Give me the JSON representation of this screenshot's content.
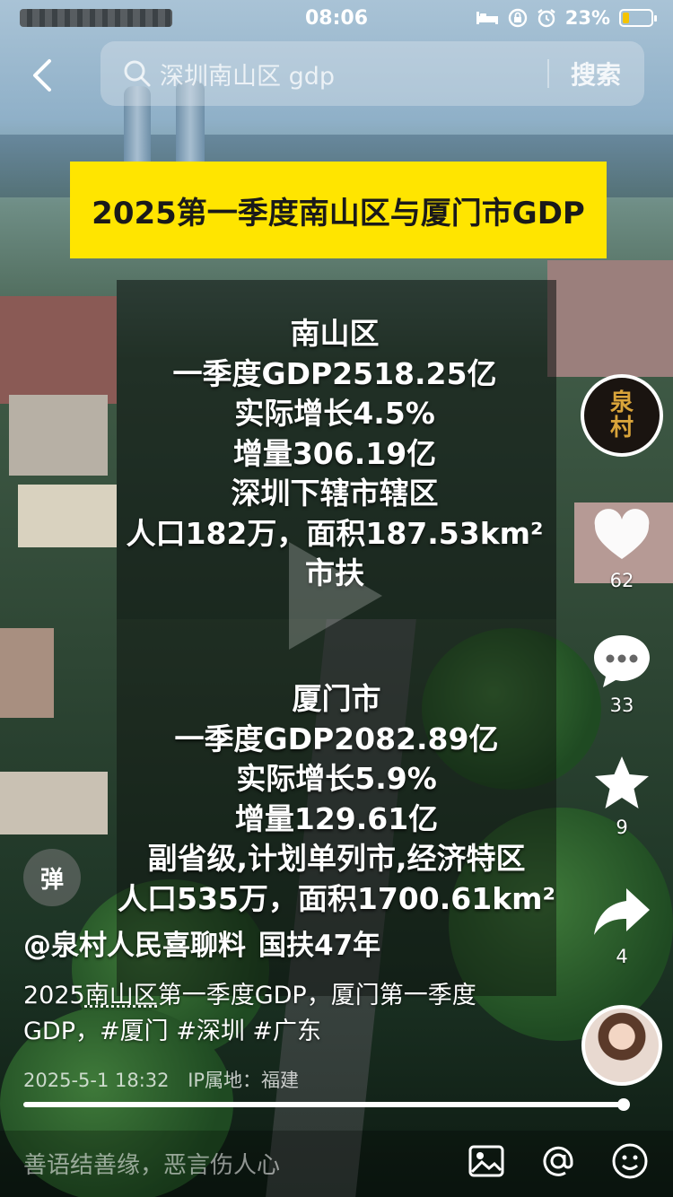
{
  "status_bar": {
    "time": "08:06",
    "battery_percent": "23%",
    "battery_level": 0.23
  },
  "search": {
    "query": "深圳南山区 gdp",
    "button_label": "搜索"
  },
  "banner": {
    "title": "2025第一季度南山区与厦门市GDP"
  },
  "panel_nanshan": {
    "lines": [
      "南山区",
      "一季度GDP2518.25亿",
      "实际增长4.5%",
      "增量306.19亿",
      "深圳下辖市辖区",
      "人口182万，面积187.53km²",
      "市扶"
    ]
  },
  "panel_xiamen": {
    "lines": [
      "厦门市",
      "一季度GDP2082.89亿",
      "实际增长5.9%",
      "增量129.61亿",
      "副省级,计划单列市,经济特区",
      "人口535万，面积1700.61km²"
    ]
  },
  "creator": {
    "badge_text": "泉村"
  },
  "actions": {
    "likes": "62",
    "comments": "33",
    "favorites": "9",
    "shares": "4"
  },
  "danmu": {
    "label": "弹"
  },
  "caption": {
    "author": "@泉村人民喜聊料",
    "author_extra": "国扶47年",
    "desc_prefix": "2025",
    "desc_keyword": "南山区",
    "desc_rest": "第一季度GDP，厦门第一季度GDP，#厦门 #深圳 #广东",
    "date": "2025-5-1 18:32",
    "ip_location": "IP属地：福建"
  },
  "progress": {
    "fraction": 0.995
  },
  "comment_bar": {
    "placeholder": "善语结善缘，恶言伤人心"
  },
  "colors": {
    "banner": "#ffe500",
    "battery": "#f5c400",
    "logo_gold": "#d9a43a"
  },
  "icons": [
    "back-arrow-icon",
    "search-icon",
    "heart-icon",
    "comment-icon",
    "star-icon",
    "share-icon",
    "image-icon",
    "at-icon",
    "emoji-icon"
  ]
}
